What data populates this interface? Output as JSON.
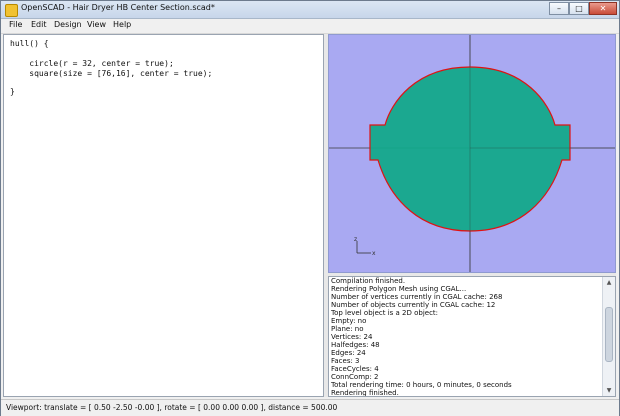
{
  "window": {
    "title": "OpenSCAD - Hair Dryer HB Center Section.scad*",
    "min_glyph": "–",
    "max_glyph": "□",
    "close_glyph": "✕"
  },
  "menu": [
    "File",
    "Edit",
    "Design",
    "View",
    "Help"
  ],
  "editor": {
    "lines": [
      "hull() {",
      "",
      "    circle(r = 32, center = true);",
      "    square(size = [76,16], center = true);",
      "",
      "}"
    ]
  },
  "viewport": {
    "background": "#a9a9f2",
    "shape_fill": "#13a88a",
    "shape_outline": "#e01212",
    "axis_color": "#3a3a3a",
    "axes_icon": {
      "z_label": "z",
      "x_label": "x"
    }
  },
  "console": {
    "lines": [
      "Compilation finished.",
      "Rendering Polygon Mesh using CGAL...",
      "Number of vertices currently in CGAL cache: 268",
      "Number of objects currently in CGAL cache: 12",
      "   Top level object is a 2D object:",
      "   Empty:        no",
      "   Plane:        no",
      "   Vertices:     24",
      "   Halfedges:    48",
      "   Edges:        24",
      "   Faces:         3",
      "   FaceCycles:    4",
      "   ConnComp:      2",
      "Total rendering time: 0 hours, 0 minutes, 0 seconds",
      "Rendering finished."
    ],
    "scroll_up_glyph": "▲",
    "scroll_down_glyph": "▼"
  },
  "status": {
    "text": "Viewport: translate = [ 0.50 -2.50 -0.00 ], rotate = [ 0.00 0.00 0.00 ], distance = 500.00"
  }
}
